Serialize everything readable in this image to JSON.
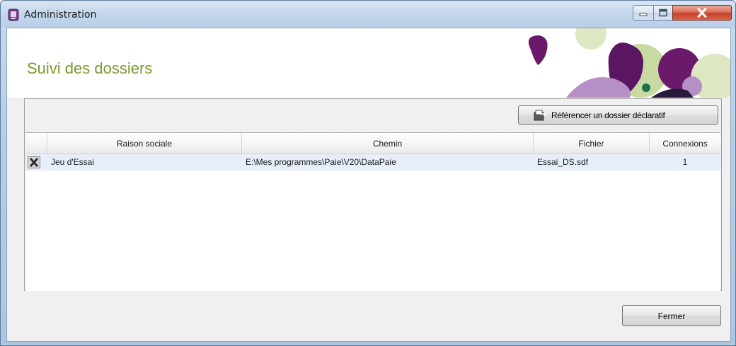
{
  "window": {
    "title": "Administration",
    "controls": {
      "minimize_icon": "minimize-icon",
      "maximize_icon": "maximize-icon",
      "close_icon": "close-icon"
    }
  },
  "header": {
    "title": "Suivi des dossiers",
    "title_color": "#7a9a2e",
    "decoration_colors": [
      "#6b1a6b",
      "#c9d9a2",
      "#b58fc6",
      "#1f6e4a",
      "#2a1a3a"
    ]
  },
  "toolbar": {
    "reference_button_label": "Référencer un dossier déclaratif",
    "reference_button_icon": "folder-reference-icon"
  },
  "table": {
    "columns": [
      "Raison sociale",
      "Chemin",
      "Fichier",
      "Connexions"
    ],
    "rows": [
      {
        "raison_sociale": "Jeu d'Essai",
        "chemin": "E:\\Mes programmes\\Paie\\V20\\DataPaie",
        "fichier": "Essai_DS.sdf",
        "connexions": "1",
        "row_icon": "delete-icon"
      }
    ]
  },
  "footer": {
    "close_button_label": "Fermer"
  }
}
